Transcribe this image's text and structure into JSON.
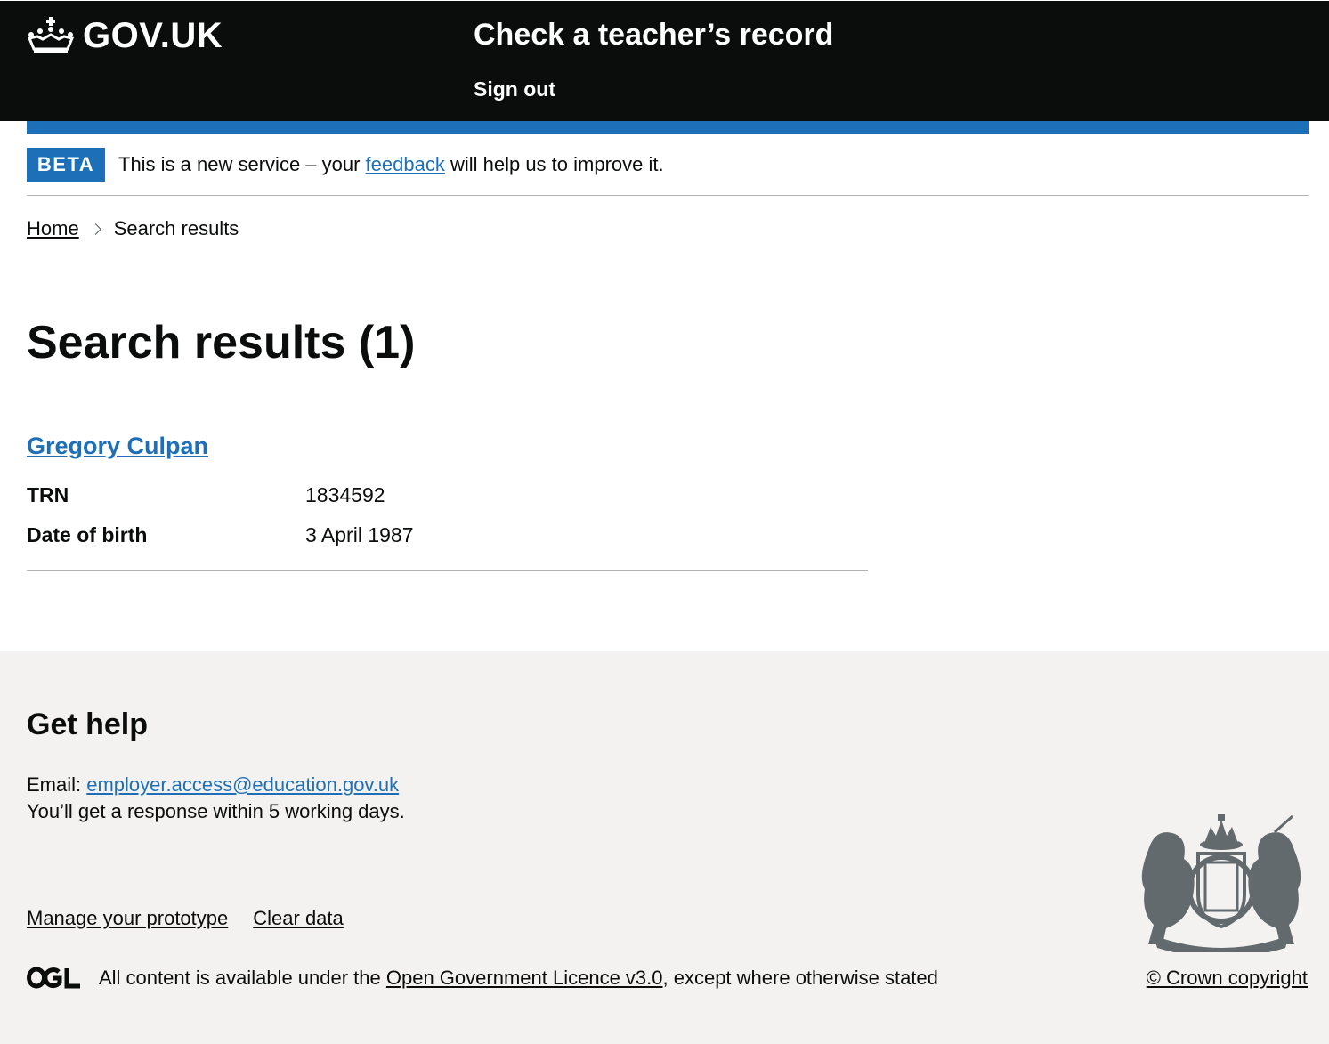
{
  "header": {
    "logo_text": "GOV.UK",
    "service_name": "Check a teacher’s record",
    "sign_out": "Sign out"
  },
  "phase_banner": {
    "tag": "BETA",
    "text_before": "This is a new service – your ",
    "link": "feedback",
    "text_after": " will help us to improve it."
  },
  "breadcrumbs": {
    "home": "Home",
    "current": "Search results"
  },
  "page_title": "Search results (1)",
  "results": [
    {
      "name": "Gregory Culpan",
      "rows": [
        {
          "key": "TRN",
          "value": "1834592"
        },
        {
          "key": "Date of birth",
          "value": "3 April 1987"
        }
      ]
    }
  ],
  "footer": {
    "help_title": "Get help",
    "email_label": "Email: ",
    "email": "employer.access@education.gov.uk",
    "response_text": "You’ll get a response within 5 working days.",
    "links": [
      "Manage your prototype",
      "Clear data"
    ],
    "licence_before": "All content is available under the ",
    "licence_link": "Open Government Licence v3.0",
    "licence_after": ", except where otherwise stated",
    "copyright": "© Crown copyright"
  },
  "colors": {
    "header_bg": "#0b0c0c",
    "brand_blue": "#1d70b8",
    "footer_bg": "#f3f2f1",
    "border_grey": "#b1b4b6"
  },
  "icons": [
    "crown-icon",
    "chevron-right-icon",
    "ogl-logo-icon",
    "royal-coat-of-arms-icon"
  ]
}
